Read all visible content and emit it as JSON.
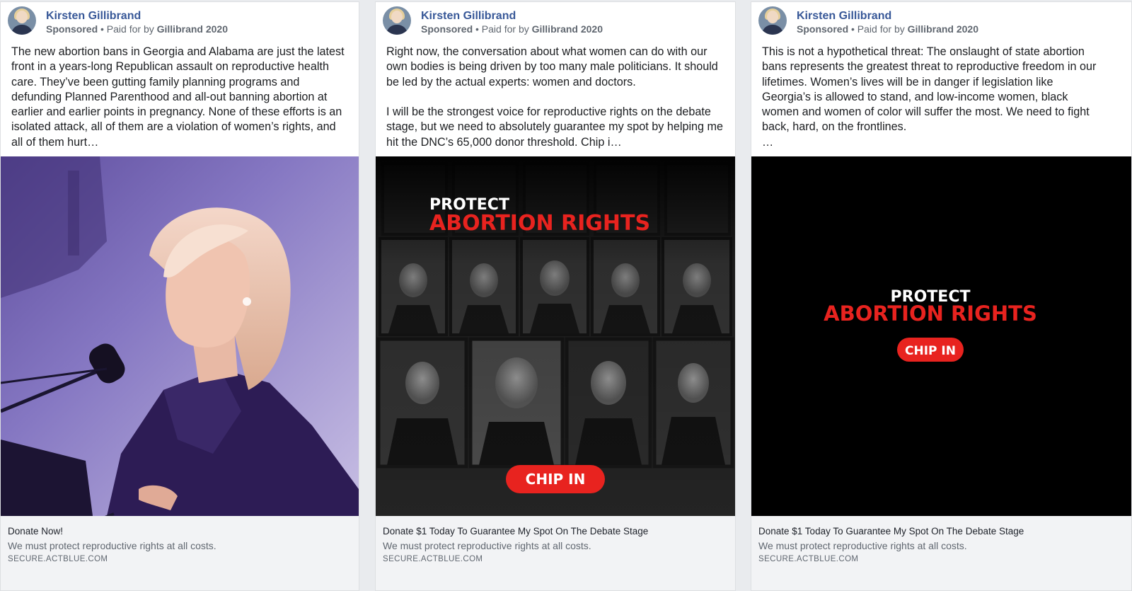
{
  "advertiser": {
    "name": "Kirsten Gillibrand",
    "sponsored": "Sponsored",
    "paid_for_prefix": "• Paid for by",
    "paid_for_by": "Gillibrand 2020"
  },
  "colors": {
    "link_blue": "#385898",
    "red": "#e8231f",
    "footer_bg": "#f2f3f5"
  },
  "ads": [
    {
      "text": "The new abortion bans in Georgia and Alabama are just the latest front in a years-long Republican assault on reproductive health care. They’ve been gutting family planning programs and defunding Planned Parenthood and all-out banning abortion at earlier and earlier points in pregnancy. None of these efforts is an isolated attack, all of them are a violation of women’s rights, and all of them hurt…",
      "headline": "Donate Now!",
      "description": "We must protect reproductive rights at all costs.",
      "domain": "SECURE.ACTBLUE.COM"
    },
    {
      "text": "Right now, the conversation about what women can do with our own bodies is being driven by too many male politicians. It should be led by the actual experts: women and doctors.\n\nI will be the strongest voice for reproductive rights on the debate stage, but we need to absolutely guarantee my spot by helping me hit the DNC’s 65,000 donor threshold. Chip i…",
      "headline": "Donate $1 Today To Guarantee My Spot On The Debate Stage",
      "description": "We must protect reproductive rights at all costs.",
      "domain": "SECURE.ACTBLUE.COM",
      "graphic": {
        "line1": "PROTECT",
        "line2": "ABORTION RIGHTS",
        "button": "CHIP IN"
      }
    },
    {
      "text": "This is not a hypothetical threat: The onslaught of state abortion bans represents the greatest threat to reproductive freedom in our lifetimes. Women’s lives will be in danger if legislation like Georgia’s is allowed to stand, and low-income women, black women and women of color will suffer the most. We need to fight back, hard, on the frontlines.\n…",
      "headline": "Donate $1 Today To Guarantee My Spot On The Debate Stage",
      "description": "We must protect reproductive rights at all costs.",
      "domain": "SECURE.ACTBLUE.COM",
      "graphic": {
        "line1": "PROTECT",
        "line2": "ABORTION RIGHTS",
        "button": "CHIP IN"
      }
    }
  ]
}
